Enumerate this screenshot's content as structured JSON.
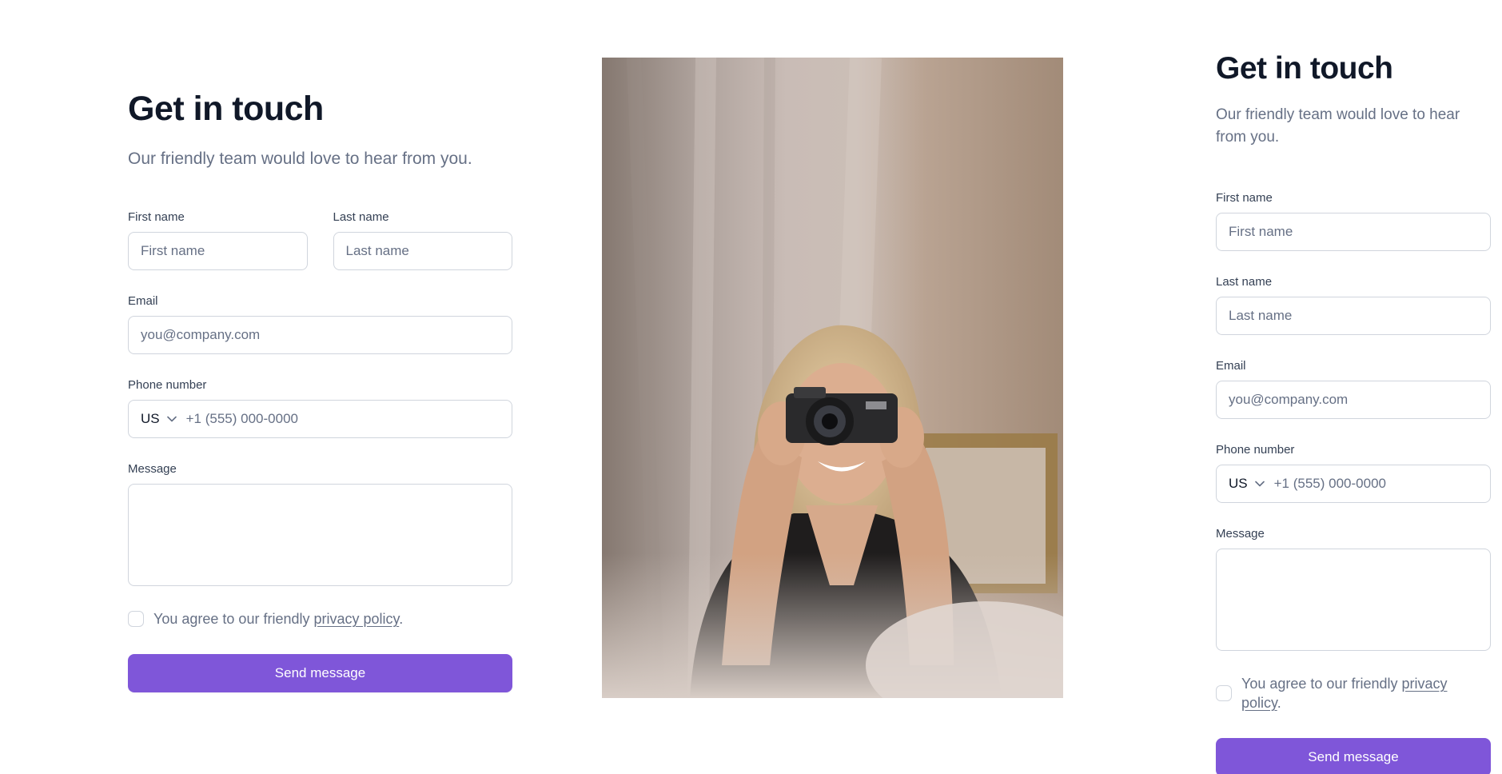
{
  "left_form": {
    "title": "Get in touch",
    "subtitle": "Our friendly team would love to hear from you.",
    "first_name_label": "First name",
    "first_name_placeholder": "First name",
    "last_name_label": "Last name",
    "last_name_placeholder": "Last name",
    "email_label": "Email",
    "email_placeholder": "you@company.com",
    "phone_label": "Phone number",
    "phone_country": "US",
    "phone_placeholder": "+1 (555) 000-0000",
    "message_label": "Message",
    "message_value": "",
    "agree_prefix": "You agree to our friendly ",
    "agree_link": "privacy policy",
    "agree_suffix": ".",
    "submit_label": "Send message"
  },
  "right_form": {
    "title": "Get in touch",
    "subtitle": "Our friendly team would love to hear from you.",
    "first_name_label": "First name",
    "first_name_placeholder": "First name",
    "last_name_label": "Last name",
    "last_name_placeholder": "Last name",
    "email_label": "Email",
    "email_placeholder": "you@company.com",
    "phone_label": "Phone number",
    "phone_country": "US",
    "phone_placeholder": "+1 (555) 000-0000",
    "message_label": "Message",
    "message_value": "",
    "agree_prefix": "You agree to our friendly ",
    "agree_link": "privacy policy",
    "agree_suffix": ".",
    "submit_label": "Send message"
  },
  "photo": {
    "icon": "woman-with-camera-photo"
  },
  "colors": {
    "accent": "#7f56d9",
    "heading": "#101828",
    "muted_text": "#667085",
    "label": "#344054",
    "border": "#d0d5dd"
  }
}
